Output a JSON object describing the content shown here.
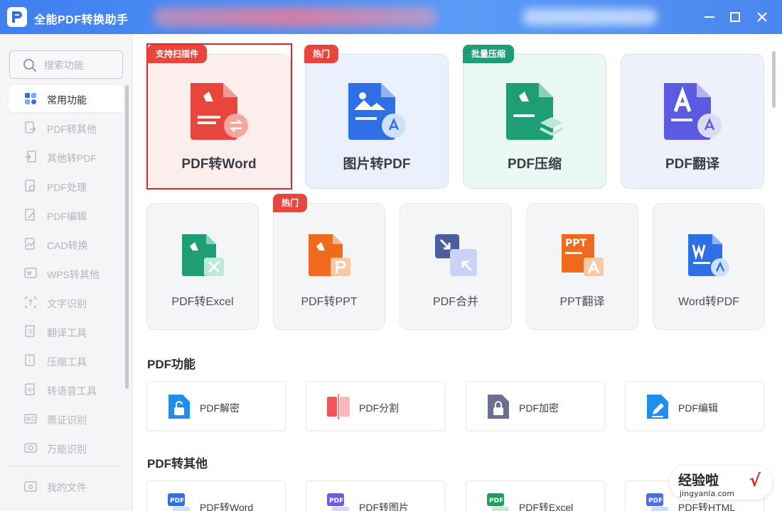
{
  "app": {
    "title": "全能PDF转换助手"
  },
  "search": {
    "placeholder": "搜索功能"
  },
  "sidebar": {
    "items": [
      {
        "label": "常用功能",
        "icon": "star-grid-icon",
        "active": true
      },
      {
        "label": "PDF转其他",
        "icon": "pdf-export-icon"
      },
      {
        "label": "其他转PDF",
        "icon": "pdf-import-icon"
      },
      {
        "label": "PDF处理",
        "icon": "pdf-process-icon"
      },
      {
        "label": "PDF编辑",
        "icon": "pdf-edit-icon"
      },
      {
        "label": "CAD转换",
        "icon": "cad-icon"
      },
      {
        "label": "WPS转其他",
        "icon": "wps-icon"
      },
      {
        "label": "文字识别",
        "icon": "ocr-icon"
      },
      {
        "label": "翻译工具",
        "icon": "translate-icon"
      },
      {
        "label": "压缩工具",
        "icon": "compress-icon"
      },
      {
        "label": "转语音工具",
        "icon": "audio-icon"
      },
      {
        "label": "票证识别",
        "icon": "ticket-icon"
      },
      {
        "label": "万能识别",
        "icon": "scan-icon"
      }
    ],
    "my_files": {
      "label": "我的文件",
      "icon": "folder-icon"
    }
  },
  "featured": [
    {
      "title": "PDF转Word",
      "badge": "支持扫描件",
      "selected": true
    },
    {
      "title": "图片转PDF",
      "badge": "热门"
    },
    {
      "title": "PDF压缩",
      "badge": "批量压缩"
    },
    {
      "title": "PDF翻译",
      "badge": ""
    }
  ],
  "tools": [
    {
      "title": "PDF转Excel",
      "badge": ""
    },
    {
      "title": "PDF转PPT",
      "badge": "热门"
    },
    {
      "title": "PDF合并",
      "badge": ""
    },
    {
      "title": "PPT翻译",
      "badge": ""
    },
    {
      "title": "Word转PDF",
      "badge": ""
    }
  ],
  "sections": {
    "pdf_functions": {
      "title": "PDF功能",
      "items": [
        "PDF解密",
        "PDF分割",
        "PDF加密",
        "PDF编辑"
      ]
    },
    "pdf_to_other": {
      "title": "PDF转其他",
      "items": [
        "PDF转Word",
        "PDF转图片",
        "PDF转Excel",
        "PDF转HTML"
      ]
    }
  },
  "colors": {
    "titlebar": "#4a86ee",
    "pdf_red": "#e8453c",
    "badge_green": "#1f9e76",
    "selection": "#e0262b"
  },
  "watermark": {
    "text": "经验啦",
    "check": "√",
    "url": "jingyanla.com"
  }
}
